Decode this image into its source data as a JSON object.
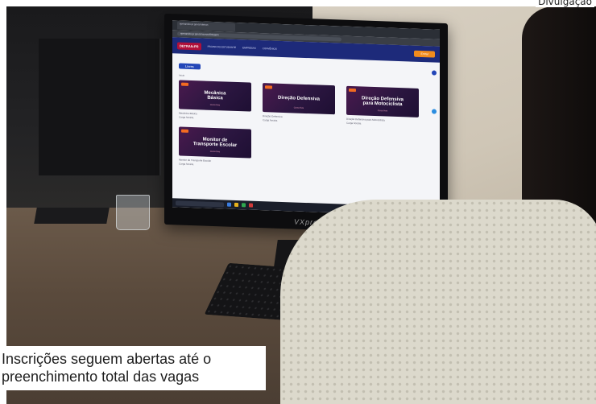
{
  "photo": {
    "credit": "Divulgação"
  },
  "caption": {
    "line1": "Inscrições seguem abertas até o",
    "line2": "preenchimento total das vagas"
  },
  "monitor": {
    "brand": "VXpro"
  },
  "screen": {
    "browser": {
      "tab_title": "ejetransito.pr.gov.br/detran",
      "url": "ejetransito.pr.gov.br/cursos/listagem"
    },
    "site": {
      "header_logo": "DETRAN-PR",
      "nav": [
        "PÁGINA DO ESTUDANTE",
        "EMPRESAS",
        "CONVÊNIOS"
      ],
      "cta": "Entrar"
    },
    "section_tab": "Livres",
    "breadcrumb": "Início",
    "courses": [
      {
        "title_line1": "Mecânica",
        "title_line2": "Básica",
        "subtitle": "Curso livre",
        "name": "Mecânica Básica",
        "meta": "Carga horária"
      },
      {
        "title_line1": "Direção Defensiva",
        "title_line2": "",
        "subtitle": "Curso livre",
        "name": "Direção Defensiva",
        "meta": "Carga horária"
      },
      {
        "title_line1": "Direção Defensiva",
        "title_line2": "para Motociclista",
        "subtitle": "Curso livre",
        "name": "Direção Defensiva para Motociclista",
        "meta": "Carga horária"
      },
      {
        "title_line1": "Monitor de",
        "title_line2": "Transporte Escolar",
        "subtitle": "Curso livre",
        "name": "Monitor de Transporte Escolar",
        "meta": "Carga horária"
      }
    ],
    "taskbar": {
      "time": "15:42"
    }
  }
}
